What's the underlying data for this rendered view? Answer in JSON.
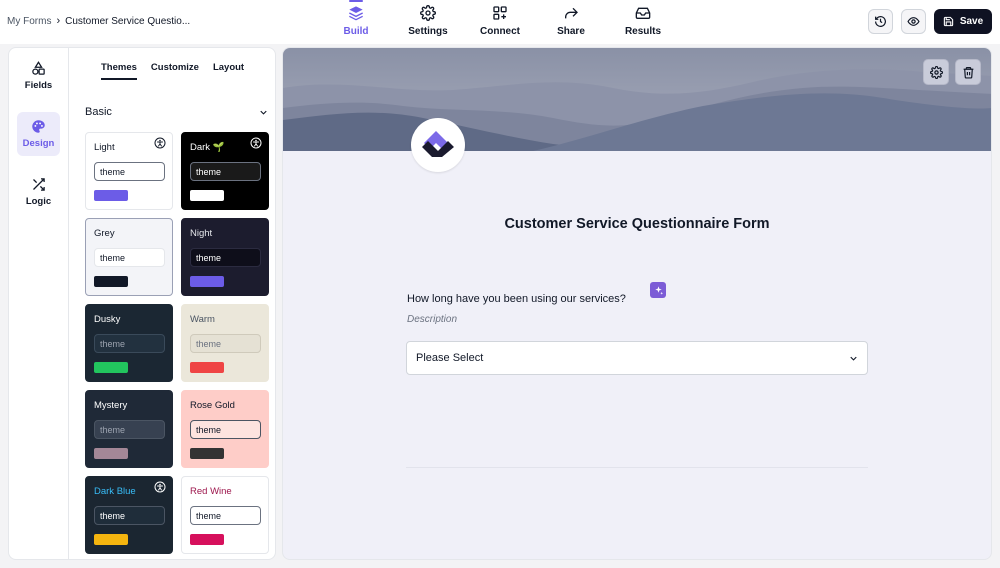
{
  "breadcrumb": {
    "root": "My Forms",
    "separator": "›",
    "current": "Customer Service Questio..."
  },
  "nav": [
    {
      "label": "Build",
      "icon": "layers-icon",
      "active": true
    },
    {
      "label": "Settings",
      "icon": "gear-icon"
    },
    {
      "label": "Connect",
      "icon": "grid-plus-icon"
    },
    {
      "label": "Share",
      "icon": "share-arrow-icon"
    },
    {
      "label": "Results",
      "icon": "inbox-icon"
    }
  ],
  "toolbar": {
    "history_icon": "history-icon",
    "preview_icon": "eye-icon",
    "save_label": "Save"
  },
  "rail": [
    {
      "label": "Fields",
      "icon": "shapes-icon"
    },
    {
      "label": "Design",
      "icon": "palette-icon",
      "active": true
    },
    {
      "label": "Logic",
      "icon": "shuffle-icon"
    }
  ],
  "subtabs": {
    "themes": "Themes",
    "customize": "Customize",
    "layout": "Layout"
  },
  "section": {
    "title": "Basic"
  },
  "themes": [
    {
      "name": "Light",
      "input": "theme",
      "bg": "#ffffff",
      "nameColor": "#111827",
      "inputBg": "#ffffff",
      "inputBorder": "#6b7280",
      "inputText": "#111827",
      "swatch": "#6c5ce7",
      "accessible": true
    },
    {
      "name": "Dark 🌱",
      "input": "theme",
      "bg": "#000000",
      "nameColor": "#ffffff",
      "inputBg": "#1a1a1a",
      "inputBorder": "#6b7280",
      "inputText": "#ffffff",
      "swatch": "#ffffff",
      "accessible": true
    },
    {
      "name": "Grey",
      "input": "theme",
      "bg": "#f3f4f8",
      "nameColor": "#111827",
      "inputBg": "#ffffff",
      "inputBorder": "#e5e7eb",
      "inputText": "#111827",
      "swatch": "#111827",
      "accessible": false
    },
    {
      "name": "Night",
      "input": "theme",
      "bg": "#1c1c2e",
      "nameColor": "#e5e7eb",
      "inputBg": "#0e0e1a",
      "inputBorder": "#2b2b40",
      "inputText": "#ffffff",
      "swatch": "#6c5ce7",
      "accessible": false
    },
    {
      "name": "Dusky",
      "input": "theme",
      "bg": "#1b2733",
      "nameColor": "#ffffff",
      "inputBg": "#22313f",
      "inputBorder": "#3a4a5a",
      "inputText": "#9ca3af",
      "swatch": "#22c55e",
      "accessible": false
    },
    {
      "name": "Warm",
      "input": "theme",
      "bg": "#ebe7da",
      "nameColor": "#4b5563",
      "inputBg": "#e5e1d4",
      "inputBorder": "#cfcabb",
      "inputText": "#6b7280",
      "swatch": "#ef4444",
      "accessible": false
    },
    {
      "name": "Mystery",
      "input": "theme",
      "bg": "#1f2937",
      "nameColor": "#ffffff",
      "inputBg": "#374151",
      "inputBorder": "#4b5563",
      "inputText": "#9ca3af",
      "swatch": "#a48797",
      "accessible": false
    },
    {
      "name": "Rose Gold",
      "input": "theme",
      "bg": "#fecdc8",
      "nameColor": "#111827",
      "inputBg": "#fde3df",
      "inputBorder": "#4b5563",
      "inputText": "#111827",
      "swatch": "#333333",
      "accessible": false
    },
    {
      "name": "Dark Blue",
      "input": "theme",
      "bg": "#1b2631",
      "nameColor": "#38bdf8",
      "inputBg": "#1f2d3a",
      "inputBorder": "#4b5563",
      "inputText": "#ffffff",
      "swatch": "#f5b50f",
      "accessible": true
    },
    {
      "name": "Red Wine",
      "input": "theme",
      "bg": "#ffffff",
      "nameColor": "#9d174d",
      "inputBg": "#ffffff",
      "inputBorder": "#6b7280",
      "inputText": "#111827",
      "swatch": "#d6105c",
      "accessible": false
    }
  ],
  "form": {
    "title": "Customer Service Questionnaire Form",
    "question": "How long have you been using our services?",
    "description": "Description",
    "select_value": "Please Select"
  },
  "colors": {
    "accent": "#6c5ce7",
    "save_bg": "#0f1222"
  }
}
